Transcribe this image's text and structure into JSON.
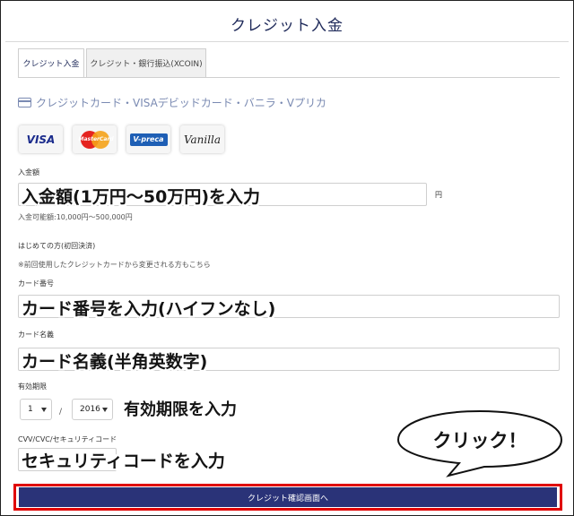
{
  "header": {
    "title": "クレジット入金"
  },
  "tabs": [
    {
      "label": "クレジット入金",
      "active": true
    },
    {
      "label": "クレジット・銀行振込(XCOIN)",
      "active": false
    }
  ],
  "payment_methods": {
    "icon": "credit-card-icon",
    "label": "クレジットカード・VISAデビッドカード・バニラ・Vプリカ"
  },
  "brands": {
    "visa": "VISA",
    "mastercard": "MasterCard",
    "vpreca": "V-preca",
    "vanilla": "Vanilla"
  },
  "amount": {
    "label": "入金額",
    "unit": "円",
    "note": "入金可能額:10,000円〜500,000円",
    "annotation": "入金額(1万円〜50万円)を入力"
  },
  "first_time": {
    "heading": "はじめての方(初回決済)",
    "note": "※前回使用したクレジットカードから変更される方もこちら"
  },
  "card_number": {
    "label": "カード番号",
    "annotation": "カード番号を入力(ハイフンなし)"
  },
  "card_name": {
    "label": "カード名義",
    "annotation": "カード名義(半角英数字)"
  },
  "expiry": {
    "label": "有効期限",
    "month": "1",
    "separator": "/",
    "year": "2016",
    "annotation": "有効期限を入力"
  },
  "cvv": {
    "label": "CVV/CVC/セキュリティコード",
    "annotation": "セキュリティコードを入力"
  },
  "callout": {
    "text": "クリック！"
  },
  "submit": {
    "label": "クレジット確認画面へ"
  },
  "colors": {
    "accent": "#2a3378",
    "highlight": "#e00000",
    "title": "#1f2a5a"
  }
}
